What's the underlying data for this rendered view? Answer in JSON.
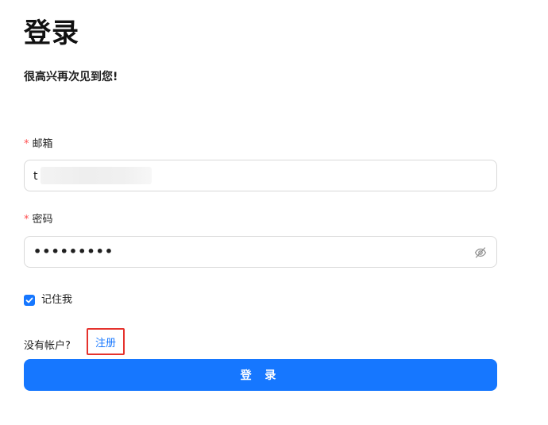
{
  "header": {
    "title": "登录",
    "subtitle": "很高兴再次见到您!"
  },
  "form": {
    "email": {
      "required_mark": "*",
      "label": "邮箱",
      "value_visible": "t"
    },
    "password": {
      "required_mark": "*",
      "label": "密码",
      "masked_value": "•••••••••",
      "toggle_icon": "eye-invisible-icon"
    },
    "remember": {
      "label": "记住我",
      "checked": true
    },
    "signup": {
      "prompt": "没有帐户?",
      "link_label": "注册"
    },
    "submit_label": "登 录"
  },
  "colors": {
    "primary": "#1677ff",
    "required": "#ff4d4f",
    "highlight_border": "#e5322d"
  }
}
